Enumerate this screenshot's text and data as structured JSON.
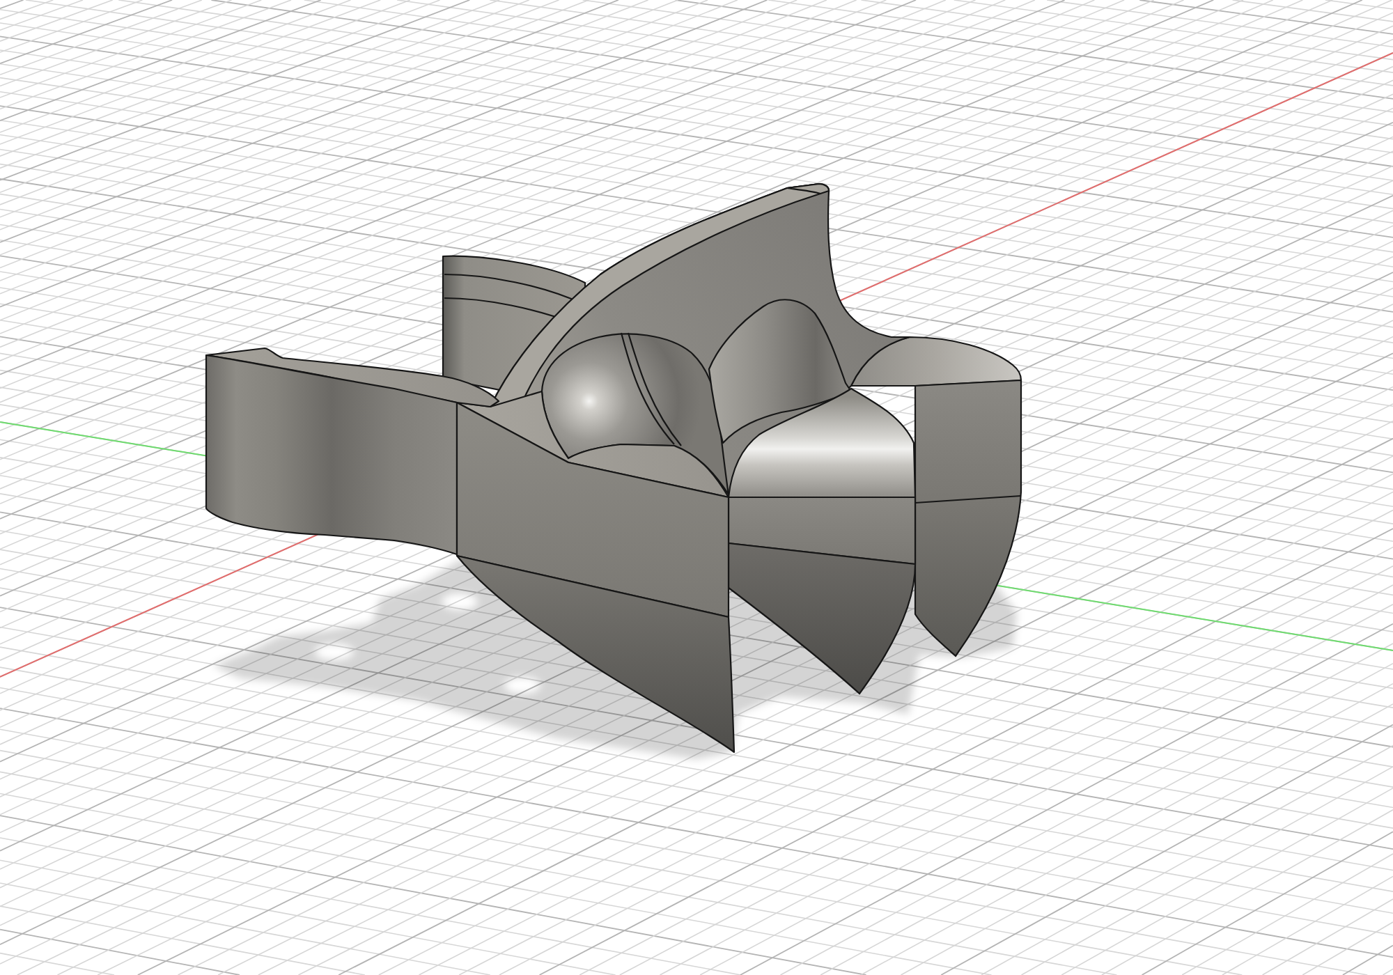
{
  "viewport": {
    "axes": [
      {
        "kind": "x",
        "color": "#e36d6d"
      },
      {
        "kind": "y",
        "color": "#6fdc6f"
      }
    ]
  }
}
